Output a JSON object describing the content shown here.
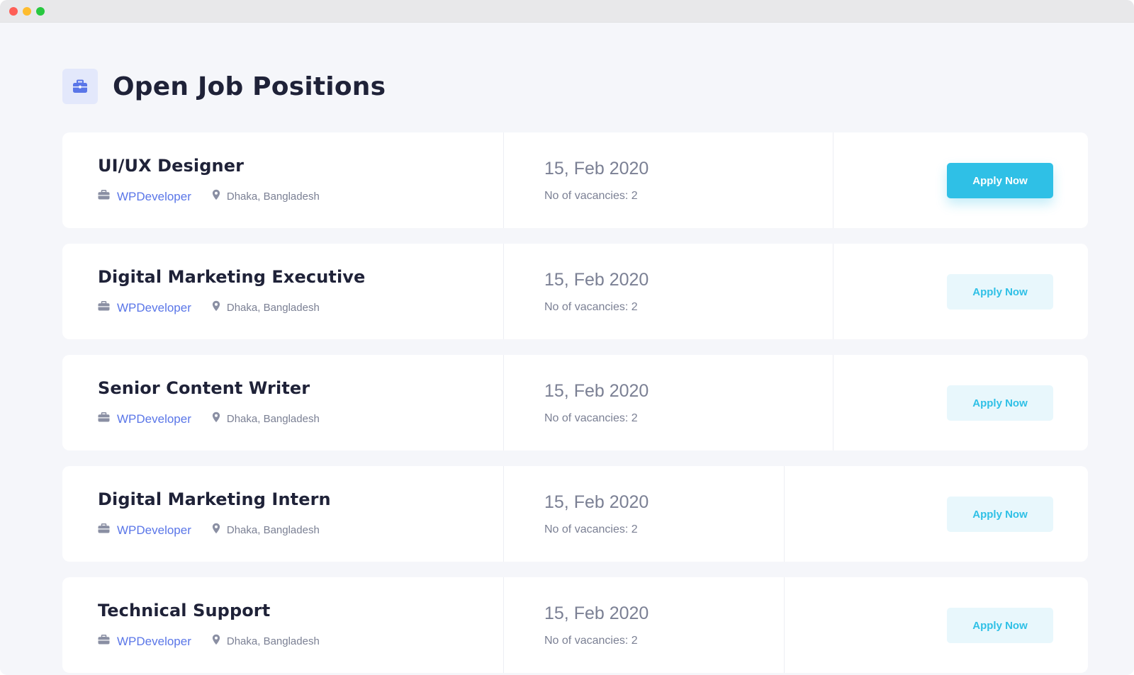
{
  "window": {
    "controls": [
      "close",
      "minimize",
      "maximize"
    ]
  },
  "header": {
    "title": "Open Job Positions",
    "icon": "briefcase-icon"
  },
  "colors": {
    "accent": "#2fc0e6",
    "link": "#5a76e8",
    "title": "#1f2238",
    "muted": "#7b8094"
  },
  "jobs": [
    {
      "title": "UI/UX Designer",
      "company": "WPDeveloper",
      "location": "Dhaka, Bangladesh",
      "date": "15, Feb 2020",
      "vacancies": "No of vacancies: 2",
      "apply_label": "Apply Now",
      "highlighted": true
    },
    {
      "title": "Digital Marketing Executive",
      "company": "WPDeveloper",
      "location": "Dhaka, Bangladesh",
      "date": "15, Feb 2020",
      "vacancies": "No of vacancies: 2",
      "apply_label": "Apply Now",
      "highlighted": false
    },
    {
      "title": "Senior Content Writer",
      "company": "WPDeveloper",
      "location": "Dhaka, Bangladesh",
      "date": "15, Feb 2020",
      "vacancies": "No of vacancies: 2",
      "apply_label": "Apply Now",
      "highlighted": false
    },
    {
      "title": "Digital Marketing Intern",
      "company": "WPDeveloper",
      "location": "Dhaka, Bangladesh",
      "date": "15, Feb 2020",
      "vacancies": "No of vacancies: 2",
      "apply_label": "Apply Now",
      "highlighted": false
    },
    {
      "title": "Technical Support",
      "company": "WPDeveloper",
      "location": "Dhaka, Bangladesh",
      "date": "15, Feb 2020",
      "vacancies": "No of vacancies: 2",
      "apply_label": "Apply Now",
      "highlighted": false
    }
  ]
}
